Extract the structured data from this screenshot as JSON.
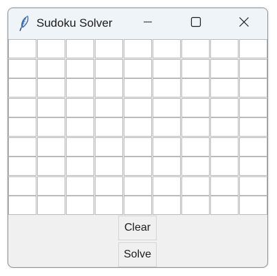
{
  "window": {
    "title": "Sudoku Solver",
    "controls": {
      "minimize": "minimize",
      "maximize": "maximize",
      "close": "close"
    }
  },
  "grid": {
    "rows": 9,
    "cols": 9,
    "values": [
      [
        "",
        "",
        "",
        "",
        "",
        "",
        "",
        "",
        ""
      ],
      [
        "",
        "",
        "",
        "",
        "",
        "",
        "",
        "",
        ""
      ],
      [
        "",
        "",
        "",
        "",
        "",
        "",
        "",
        "",
        ""
      ],
      [
        "",
        "",
        "",
        "",
        "",
        "",
        "",
        "",
        ""
      ],
      [
        "",
        "",
        "",
        "",
        "",
        "",
        "",
        "",
        ""
      ],
      [
        "",
        "",
        "",
        "",
        "",
        "",
        "",
        "",
        ""
      ],
      [
        "",
        "",
        "",
        "",
        "",
        "",
        "",
        "",
        ""
      ],
      [
        "",
        "",
        "",
        "",
        "",
        "",
        "",
        "",
        ""
      ],
      [
        "",
        "",
        "",
        "",
        "",
        "",
        "",
        "",
        ""
      ]
    ]
  },
  "buttons": {
    "clear_label": "Clear",
    "solve_label": "Solve"
  },
  "icons": {
    "app": "feather-icon",
    "minimize": "minimize-icon",
    "maximize": "maximize-icon",
    "close": "close-icon"
  },
  "colors": {
    "titlebar": "#eff4f9",
    "window_bg": "#f0f0f0",
    "cell_bg": "#ffffff",
    "cell_border": "#b9b9b9"
  }
}
